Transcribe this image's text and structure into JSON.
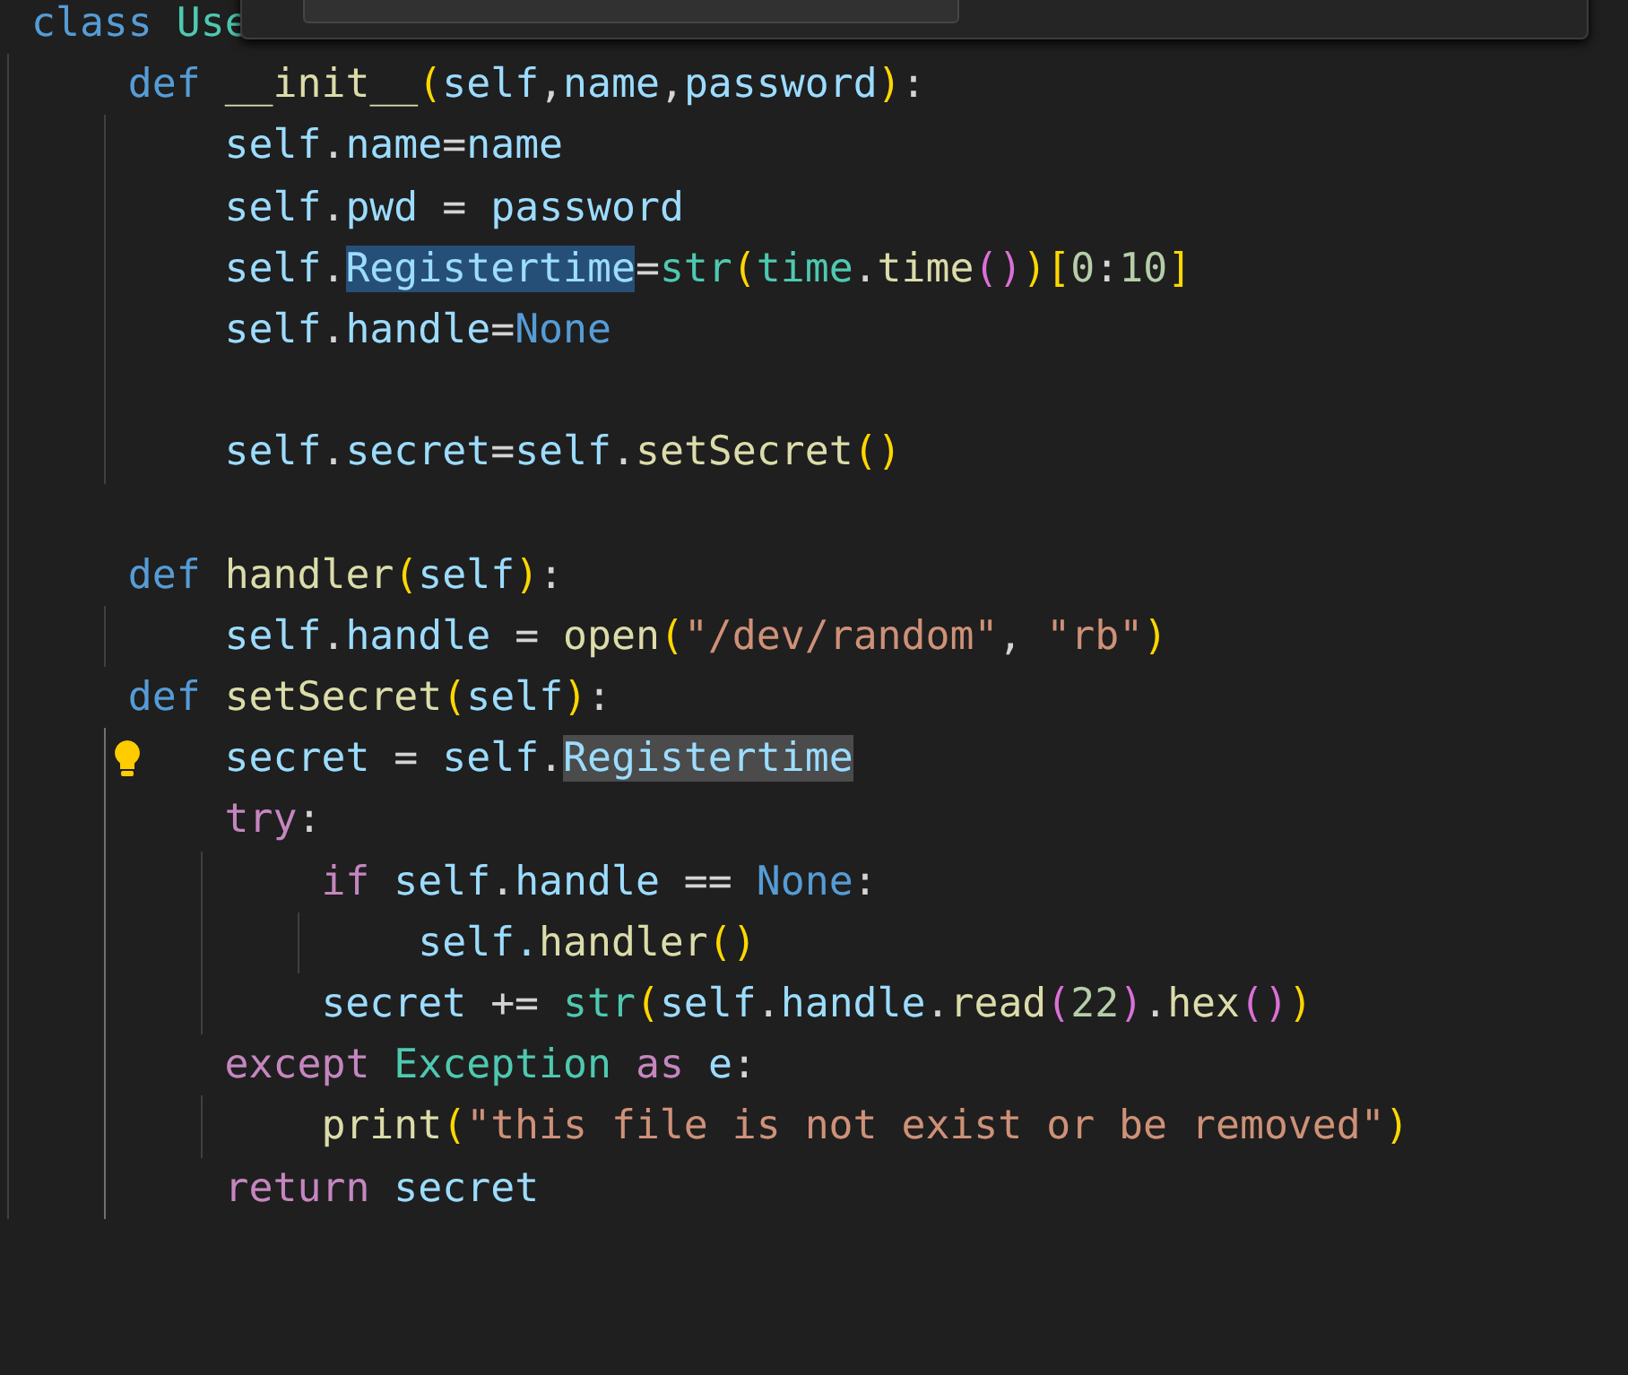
{
  "find_widget": {
    "kind": "panel"
  },
  "code": [
    {
      "kind": "code",
      "tokens": [
        {
          "text": "class ",
          "kind": "keyword"
        },
        {
          "text": "Use",
          "kind": "type"
        }
      ],
      "children": [
        {
          "kind": "code",
          "tokens": [
            {
              "text": "def ",
              "kind": "keyword"
            },
            {
              "text": "__init__",
              "kind": "function"
            },
            {
              "text": "(",
              "kind": "bracket1"
            },
            {
              "text": "self",
              "kind": "variable"
            },
            {
              "text": ",",
              "kind": "plain"
            },
            {
              "text": "name",
              "kind": "variable"
            },
            {
              "text": ",",
              "kind": "plain"
            },
            {
              "text": "password",
              "kind": "variable"
            },
            {
              "text": ")",
              "kind": "bracket1"
            },
            {
              "text": ":",
              "kind": "plain"
            }
          ],
          "children": [
            {
              "kind": "code",
              "tokens": [
                {
                  "text": "self",
                  "kind": "variable"
                },
                {
                  "text": ".",
                  "kind": "plain"
                },
                {
                  "text": "name",
                  "kind": "variable"
                },
                {
                  "text": "=",
                  "kind": "plain"
                },
                {
                  "text": "name",
                  "kind": "variable"
                }
              ]
            },
            {
              "kind": "code",
              "tokens": [
                {
                  "text": "self",
                  "kind": "variable"
                },
                {
                  "text": ".",
                  "kind": "plain"
                },
                {
                  "text": "pwd",
                  "kind": "variable"
                },
                {
                  "text": " = ",
                  "kind": "plain"
                },
                {
                  "text": "password",
                  "kind": "variable"
                }
              ]
            },
            {
              "kind": "code",
              "tokens": [
                {
                  "text": "self",
                  "kind": "variable"
                },
                {
                  "text": ".",
                  "kind": "plain"
                },
                {
                  "text": "Registertime",
                  "kind": "variable",
                  "selected": true
                },
                {
                  "text": "=",
                  "kind": "plain"
                },
                {
                  "text": "str",
                  "kind": "type"
                },
                {
                  "text": "(",
                  "kind": "bracket1"
                },
                {
                  "text": "time",
                  "kind": "type"
                },
                {
                  "text": ".",
                  "kind": "plain"
                },
                {
                  "text": "time",
                  "kind": "function"
                },
                {
                  "text": "()",
                  "kind": "bracket2"
                },
                {
                  "text": ")[",
                  "kind": "bracket1"
                },
                {
                  "text": "0",
                  "kind": "number"
                },
                {
                  "text": ":",
                  "kind": "plain"
                },
                {
                  "text": "10",
                  "kind": "number"
                },
                {
                  "text": "]",
                  "kind": "bracket1"
                }
              ]
            },
            {
              "kind": "code",
              "tokens": [
                {
                  "text": "self",
                  "kind": "variable"
                },
                {
                  "text": ".",
                  "kind": "plain"
                },
                {
                  "text": "handle",
                  "kind": "variable"
                },
                {
                  "text": "=",
                  "kind": "plain"
                },
                {
                  "text": "None",
                  "kind": "keyword"
                }
              ]
            },
            {
              "kind": "blank"
            },
            {
              "kind": "code",
              "tokens": [
                {
                  "text": "self",
                  "kind": "variable"
                },
                {
                  "text": ".",
                  "kind": "plain"
                },
                {
                  "text": "secret",
                  "kind": "variable"
                },
                {
                  "text": "=",
                  "kind": "plain"
                },
                {
                  "text": "self",
                  "kind": "variable"
                },
                {
                  "text": ".",
                  "kind": "plain"
                },
                {
                  "text": "setSecret",
                  "kind": "function"
                },
                {
                  "text": "()",
                  "kind": "bracket1"
                }
              ]
            }
          ]
        },
        {
          "kind": "blank"
        },
        {
          "kind": "code",
          "tokens": [
            {
              "text": "def ",
              "kind": "keyword"
            },
            {
              "text": "handler",
              "kind": "function"
            },
            {
              "text": "(",
              "kind": "bracket1"
            },
            {
              "text": "self",
              "kind": "variable"
            },
            {
              "text": ")",
              "kind": "bracket1"
            },
            {
              "text": ":",
              "kind": "plain"
            }
          ],
          "children": [
            {
              "kind": "code",
              "tokens": [
                {
                  "text": "self",
                  "kind": "variable"
                },
                {
                  "text": ".",
                  "kind": "plain"
                },
                {
                  "text": "handle",
                  "kind": "variable"
                },
                {
                  "text": " = ",
                  "kind": "plain"
                },
                {
                  "text": "open",
                  "kind": "function"
                },
                {
                  "text": "(",
                  "kind": "bracket1"
                },
                {
                  "text": "\"/dev/random\"",
                  "kind": "string"
                },
                {
                  "text": ", ",
                  "kind": "plain"
                },
                {
                  "text": "\"rb\"",
                  "kind": "string"
                },
                {
                  "text": ")",
                  "kind": "bracket1"
                }
              ]
            }
          ]
        },
        {
          "kind": "code",
          "active_guide": true,
          "tokens": [
            {
              "text": "def ",
              "kind": "keyword"
            },
            {
              "text": "setSecret",
              "kind": "function"
            },
            {
              "text": "(",
              "kind": "bracket1"
            },
            {
              "text": "self",
              "kind": "variable"
            },
            {
              "text": ")",
              "kind": "bracket1"
            },
            {
              "text": ":",
              "kind": "plain"
            }
          ],
          "children": [
            {
              "kind": "code",
              "lightbulb": true,
              "tokens": [
                {
                  "text": "secret",
                  "kind": "variable"
                },
                {
                  "text": " = ",
                  "kind": "plain"
                },
                {
                  "text": "self",
                  "kind": "variable"
                },
                {
                  "text": ".",
                  "kind": "plain"
                },
                {
                  "text": "Registertime",
                  "kind": "variable",
                  "occurrence": true
                }
              ]
            },
            {
              "kind": "code",
              "tokens": [
                {
                  "text": "try",
                  "kind": "control"
                },
                {
                  "text": ":",
                  "kind": "plain"
                }
              ],
              "children": [
                {
                  "kind": "code",
                  "tokens": [
                    {
                      "text": "if ",
                      "kind": "control"
                    },
                    {
                      "text": "self",
                      "kind": "variable"
                    },
                    {
                      "text": ".",
                      "kind": "plain"
                    },
                    {
                      "text": "handle",
                      "kind": "variable"
                    },
                    {
                      "text": " == ",
                      "kind": "plain"
                    },
                    {
                      "text": "None",
                      "kind": "keyword"
                    },
                    {
                      "text": ":",
                      "kind": "plain"
                    }
                  ],
                  "children": [
                    {
                      "kind": "code",
                      "tokens": [
                        {
                          "text": "self.",
                          "kind": "variable"
                        },
                        {
                          "text": "handler",
                          "kind": "function"
                        },
                        {
                          "text": "()",
                          "kind": "bracket1"
                        }
                      ]
                    }
                  ]
                },
                {
                  "kind": "code",
                  "tokens": [
                    {
                      "text": "secret",
                      "kind": "variable"
                    },
                    {
                      "text": " += ",
                      "kind": "plain"
                    },
                    {
                      "text": "str",
                      "kind": "type"
                    },
                    {
                      "text": "(",
                      "kind": "bracket1"
                    },
                    {
                      "text": "self",
                      "kind": "variable"
                    },
                    {
                      "text": ".",
                      "kind": "plain"
                    },
                    {
                      "text": "handle",
                      "kind": "variable"
                    },
                    {
                      "text": ".",
                      "kind": "plain"
                    },
                    {
                      "text": "read",
                      "kind": "function"
                    },
                    {
                      "text": "(",
                      "kind": "bracket2"
                    },
                    {
                      "text": "22",
                      "kind": "number"
                    },
                    {
                      "text": ")",
                      "kind": "bracket2"
                    },
                    {
                      "text": ".",
                      "kind": "plain"
                    },
                    {
                      "text": "hex",
                      "kind": "function"
                    },
                    {
                      "text": "()",
                      "kind": "bracket2"
                    },
                    {
                      "text": ")",
                      "kind": "bracket1"
                    }
                  ]
                }
              ]
            },
            {
              "kind": "code",
              "tokens": [
                {
                  "text": "except ",
                  "kind": "control"
                },
                {
                  "text": "Exception ",
                  "kind": "type"
                },
                {
                  "text": "as ",
                  "kind": "control"
                },
                {
                  "text": "e",
                  "kind": "variable"
                },
                {
                  "text": ":",
                  "kind": "plain"
                }
              ],
              "children": [
                {
                  "kind": "code",
                  "tokens": [
                    {
                      "text": "print",
                      "kind": "function"
                    },
                    {
                      "text": "(",
                      "kind": "bracket1"
                    },
                    {
                      "text": "\"this file is not exist or be removed\"",
                      "kind": "string"
                    },
                    {
                      "text": ")",
                      "kind": "bracket1"
                    }
                  ]
                }
              ]
            },
            {
              "kind": "code",
              "tokens": [
                {
                  "text": "return ",
                  "kind": "control"
                },
                {
                  "text": "secret",
                  "kind": "variable"
                }
              ]
            }
          ]
        }
      ]
    }
  ]
}
